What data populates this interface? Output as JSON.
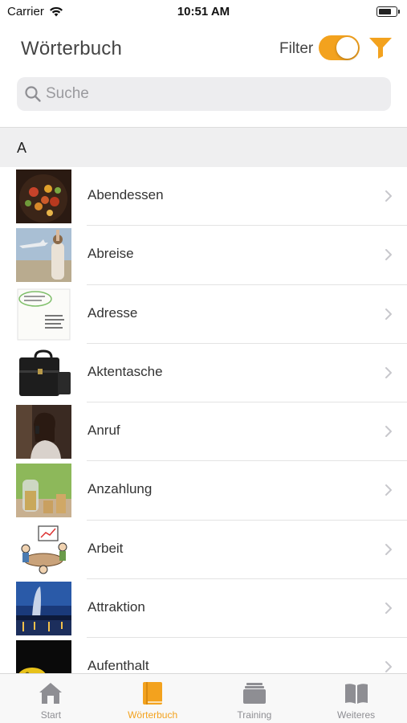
{
  "status_bar": {
    "carrier": "Carrier",
    "time": "10:51 AM"
  },
  "nav": {
    "title": "Wörterbuch",
    "filter_label": "Filter",
    "filter_enabled": true
  },
  "search": {
    "placeholder": "Suche",
    "value": ""
  },
  "section": {
    "letter": "A"
  },
  "entries": [
    {
      "label": "Abendessen",
      "thumb": "food-photo"
    },
    {
      "label": "Abreise",
      "thumb": "departure-photo"
    },
    {
      "label": "Adresse",
      "thumb": "address-card"
    },
    {
      "label": "Aktentasche",
      "thumb": "briefcase-photo"
    },
    {
      "label": "Anruf",
      "thumb": "phone-call-photo"
    },
    {
      "label": "Anzahlung",
      "thumb": "coins-photo"
    },
    {
      "label": "Arbeit",
      "thumb": "work-cartoon"
    },
    {
      "label": "Attraktion",
      "thumb": "city-night-photo"
    },
    {
      "label": "Aufenthalt",
      "thumb": "dark-photo"
    }
  ],
  "tabs": [
    {
      "label": "Start",
      "icon": "house-icon",
      "active": false
    },
    {
      "label": "Wörterbuch",
      "icon": "book-icon",
      "active": true
    },
    {
      "label": "Training",
      "icon": "cards-stack-icon",
      "active": false
    },
    {
      "label": "Weiteres",
      "icon": "open-book-icon",
      "active": false
    }
  ],
  "colors": {
    "accent": "#F3A21E",
    "inactive_tab": "#8E8E93",
    "section_bg": "#EFEFF0"
  }
}
